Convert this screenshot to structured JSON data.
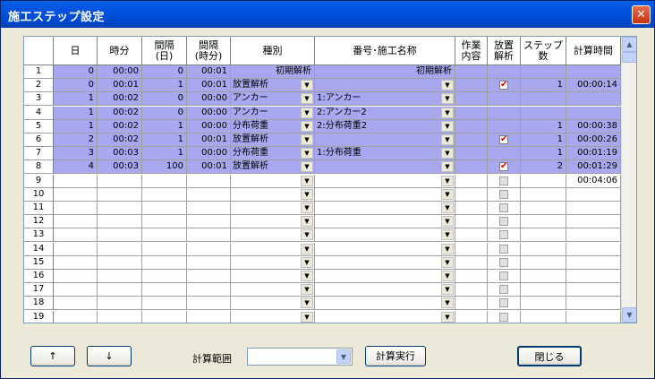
{
  "window": {
    "title": "施工ステップ設定",
    "close_glyph": "✕"
  },
  "headers": [
    "日",
    "時分",
    "間隔\n(日)",
    "間隔\n(時分)",
    "種別",
    "番号･施工名称",
    "作業\n内容",
    "放置\n解析",
    "ステップ\n数",
    "計算時間"
  ],
  "rows": [
    {
      "no": "1",
      "day": "0",
      "time": "00:00",
      "int_day": "0",
      "int_time": "00:01",
      "type": "初期解析",
      "name": "初期解析",
      "solve": "",
      "steps": "",
      "calc": "",
      "hl": true,
      "plain": true
    },
    {
      "no": "2",
      "day": "0",
      "time": "00:01",
      "int_day": "1",
      "int_time": "00:01",
      "type": "放置解析",
      "name": "",
      "solve": "on",
      "steps": "1",
      "calc": "00:00:14",
      "hl": true
    },
    {
      "no": "3",
      "day": "1",
      "time": "00:02",
      "int_day": "0",
      "int_time": "00:00",
      "type": "アンカー",
      "name": "1:アンカー",
      "solve": "",
      "steps": "",
      "calc": "",
      "hl": true
    },
    {
      "no": "4",
      "day": "1",
      "time": "00:02",
      "int_day": "0",
      "int_time": "00:00",
      "type": "アンカー",
      "name": "2:アンカー2",
      "solve": "",
      "steps": "",
      "calc": "",
      "hl": true
    },
    {
      "no": "5",
      "day": "1",
      "time": "00:02",
      "int_day": "1",
      "int_time": "00:00",
      "type": "分布荷重",
      "name": "2:分布荷重2",
      "solve": "",
      "steps": "1",
      "calc": "00:00:38",
      "hl": true
    },
    {
      "no": "6",
      "day": "2",
      "time": "00:02",
      "int_day": "1",
      "int_time": "00:01",
      "type": "放置解析",
      "name": "",
      "solve": "on",
      "steps": "1",
      "calc": "00:00:26",
      "hl": true
    },
    {
      "no": "7",
      "day": "3",
      "time": "00:03",
      "int_day": "1",
      "int_time": "00:00",
      "type": "分布荷重",
      "name": "1:分布荷重",
      "solve": "",
      "steps": "1",
      "calc": "00:01:19",
      "hl": true
    },
    {
      "no": "8",
      "day": "4",
      "time": "00:03",
      "int_day": "100",
      "int_time": "00:01",
      "type": "放置解析",
      "name": "",
      "solve": "on",
      "steps": "2",
      "calc": "00:01:29",
      "hl": true
    },
    {
      "no": "9",
      "day": "",
      "time": "",
      "int_day": "",
      "int_time": "",
      "type": "",
      "name": "",
      "solve": "off",
      "steps": "",
      "calc": "00:04:06",
      "hl": false
    },
    {
      "no": "10",
      "solve": "off",
      "hl": false
    },
    {
      "no": "11",
      "solve": "off",
      "hl": false
    },
    {
      "no": "12",
      "solve": "off",
      "hl": false
    },
    {
      "no": "13",
      "solve": "off",
      "hl": false
    },
    {
      "no": "14",
      "solve": "off",
      "hl": false
    },
    {
      "no": "15",
      "solve": "off",
      "hl": false
    },
    {
      "no": "16",
      "solve": "off",
      "hl": false
    },
    {
      "no": "17",
      "solve": "off",
      "hl": false
    },
    {
      "no": "18",
      "solve": "off",
      "hl": false
    },
    {
      "no": "19",
      "solve": "off",
      "hl": false
    }
  ],
  "buttons": {
    "up": "↑",
    "down": "↓",
    "run": "計算実行",
    "close": "閉じる"
  },
  "range": {
    "label": "計算範囲",
    "value": ""
  },
  "colors": {
    "highlight": "#a8a8f0",
    "title_bar": "#0054e3"
  }
}
